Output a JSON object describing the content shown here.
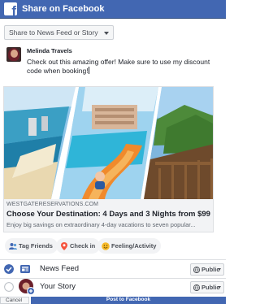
{
  "window": {
    "title": "Share on Facebook"
  },
  "destination": {
    "selected": "Share to News Feed or Story"
  },
  "composer": {
    "author": "Melinda Travels",
    "message": "Check out this amazing offer! Make sure to use my discount code when booking!"
  },
  "link_preview": {
    "domain": "WESTGATERESERVATIONS.COM",
    "title": "Choose Your Destination: 4 Days and 3 Nights from $99",
    "description": "Enjoy big savings on extraordinary 4-day vacations to seven popular..."
  },
  "actions": [
    {
      "label": "Tag Friends",
      "icon": "tag-friends-icon"
    },
    {
      "label": "Check in",
      "icon": "location-pin-icon"
    },
    {
      "label": "Feeling/Activity",
      "icon": "smiley-icon"
    }
  ],
  "share_targets": [
    {
      "label": "News Feed",
      "checked": true,
      "privacy": "Public"
    },
    {
      "label": "Your Story",
      "checked": false,
      "privacy": "Public"
    }
  ],
  "footer": {
    "cancel_label": "Cancel",
    "post_label": "Post to Facebook"
  },
  "colors": {
    "brand": "#4267b2",
    "check": "#4267b2"
  }
}
